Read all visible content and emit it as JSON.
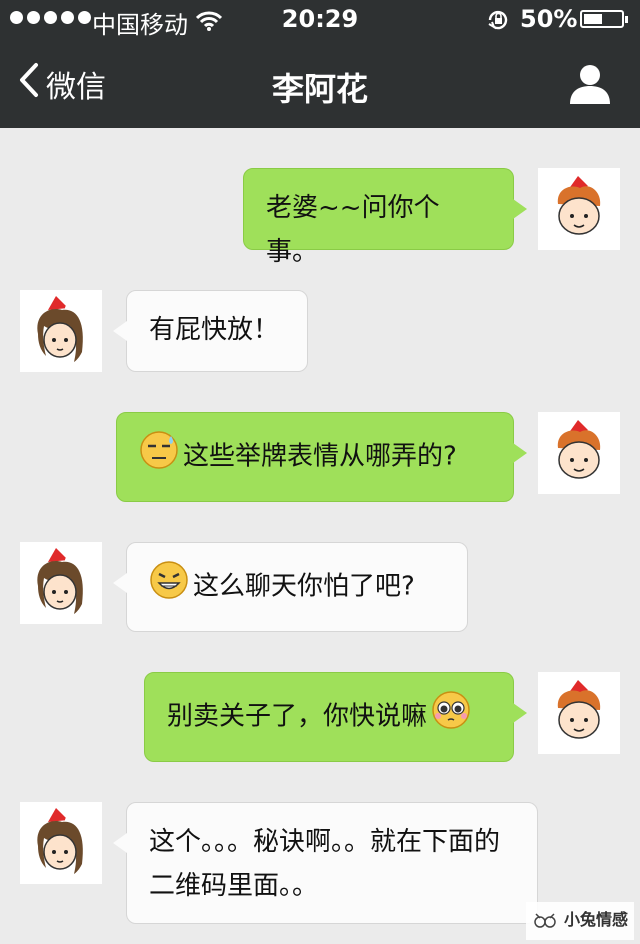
{
  "status_bar": {
    "carrier": "中国移动",
    "time": "20:29",
    "battery_percent": "50%",
    "battery_level": 0.5
  },
  "nav": {
    "back_label": "微信",
    "title": "李阿花"
  },
  "messages": [
    {
      "sender": "me",
      "text": "老婆~~问你个事。"
    },
    {
      "sender": "them",
      "text": "有屁快放！"
    },
    {
      "sender": "me",
      "emoji": "sweat-smile-emoji",
      "text": "这些举牌表情从哪弄的?"
    },
    {
      "sender": "them",
      "emoji": "grin-emoji",
      "text": "这么聊天你怕了吧?"
    },
    {
      "sender": "me",
      "text": "别卖关子了，你快说嘛",
      "emoji_after": "pleading-emoji"
    },
    {
      "sender": "them",
      "text": "这个。。。秘诀啊。。就在下面的二维码里面。。"
    }
  ],
  "watermark": {
    "text": "小兔情感"
  }
}
